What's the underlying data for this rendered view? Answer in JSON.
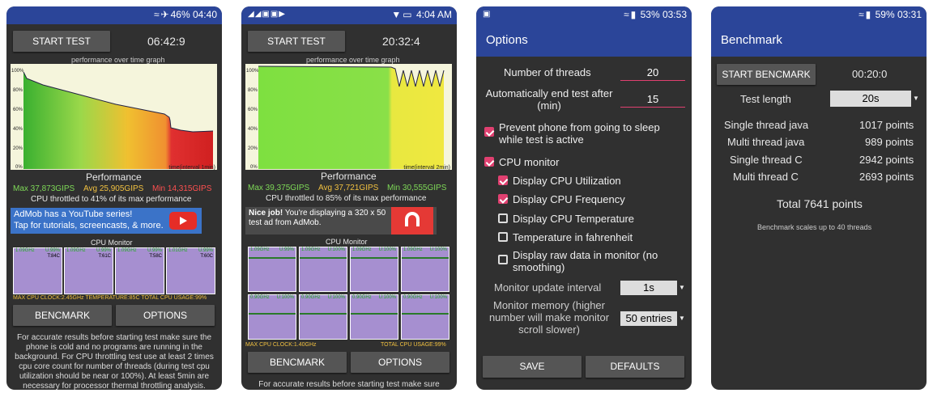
{
  "screens": [
    {
      "status": {
        "left": "",
        "right": "46% 04:40"
      },
      "start_test": "START TEST",
      "timer": "06:42:9",
      "graph_title": "performance over time graph",
      "y_ticks": [
        "100%",
        "80%",
        "60%",
        "40%",
        "20%",
        "0%"
      ],
      "graph_xlabel": "time(interval 1min)",
      "perf_label": "Performance",
      "max": "Max 37,873GIPS",
      "avg": "Avg 25,905GIPS",
      "min": "Min 14,315GIPS",
      "throttle": "CPU throttled to 41% of its max performance",
      "ad_line1": "AdMob has a YouTube series!",
      "ad_line2": "Tap for tutorials, screencasts, & more.",
      "cpu_monitor": "CPU Monitor",
      "cores": [
        {
          "ghz": "1.09GHz",
          "u": "U:99%",
          "t": "T:84C"
        },
        {
          "ghz": "1.09GHz",
          "u": "U:99%",
          "t": "T:61C"
        },
        {
          "ghz": "1.09GHz",
          "u": "U:99%",
          "t": "T:58C"
        },
        {
          "ghz": "1.01GHz",
          "u": "U:99%",
          "t": "T:60C"
        }
      ],
      "cpu_footer": "MAX CPU CLOCK:2.45GHz  TEMPERATURE:85C   TOTAL CPU USAGE:99%",
      "benchmark": "BENCMARK",
      "options": "OPTIONS",
      "info": "For accurate results before starting test make sure the phone is cold and no programs are running in the background. For CPU throttling test use at least 2 times cpu core count for number of threads (during test cpu utilization should be near or 100%). At least 5min are necessary for processor thermal throttling analysis. Phone will heat up"
    },
    {
      "status": {
        "left": "",
        "right": "4:04 AM"
      },
      "start_test": "START TEST",
      "timer": "20:32:4",
      "graph_title": "performance over time graph",
      "y_ticks": [
        "100%",
        "80%",
        "60%",
        "40%",
        "20%",
        "0%"
      ],
      "graph_xlabel": "time(interval 2min)",
      "perf_label": "Performance",
      "max": "Max 39,375GIPS",
      "avg": "Avg 37,721GIPS",
      "min": "Min 30,555GIPS",
      "throttle": "CPU throttled to 85% of its max performance",
      "ad_bold": "Nice job!",
      "ad_text": " You're displaying a 320 x 50 test ad from AdMob.",
      "cpu_monitor": "CPU Monitor",
      "cores": [
        {
          "ghz": "1.09GHz",
          "u": "U:99%"
        },
        {
          "ghz": "1.09GHz",
          "u": "U:100%"
        },
        {
          "ghz": "1.09GHz",
          "u": "U:100%"
        },
        {
          "ghz": "1.09GHz",
          "u": "U:100%"
        },
        {
          "ghz": "0.90GHz",
          "u": "U:100%"
        },
        {
          "ghz": "0.90GHz",
          "u": "U:100%"
        },
        {
          "ghz": "0.90GHz",
          "u": "U:100%"
        },
        {
          "ghz": "0.90GHz",
          "u": "U:100%"
        }
      ],
      "cpu_footer_l": "MAX CPU CLOCK:1.40GHz",
      "cpu_footer_r": "TOTAL CPU USAGE:99%",
      "benchmark": "BENCMARK",
      "options": "OPTIONS",
      "info": "For accurate results before starting test make sure"
    },
    {
      "status": {
        "right": "53% 03:53"
      },
      "title": "Options",
      "threads_label": "Number of threads",
      "threads_value": "20",
      "autoend_label": "Automatically end test after (min)",
      "autoend_value": "15",
      "prevent_sleep": "Prevent phone from going to sleep while test is active",
      "cpu_monitor": "CPU monitor",
      "disp_util": "Display CPU Utilization",
      "disp_freq": "Display CPU Frequency",
      "disp_temp": "Display CPU Temperature",
      "temp_f": "Temperature in fahrenheit",
      "raw_data": "Display raw data in monitor (no smoothing)",
      "interval_label": "Monitor update interval",
      "interval_value": "1s",
      "memory_label": "Monitor memory (higher number will make monitor scroll slower)",
      "memory_value": "50 entries",
      "save": "SAVE",
      "defaults": "DEFAULTS"
    },
    {
      "status": {
        "right": "59% 03:31"
      },
      "title": "Benchmark",
      "start": "START BENCMARK",
      "timer": "00:20:0",
      "length_label": "Test length",
      "length_value": "20s",
      "results": [
        {
          "name": "Single thread java",
          "value": "1017 points"
        },
        {
          "name": "Multi thread java",
          "value": "989 points"
        },
        {
          "name": "Single thread C",
          "value": "2942 points"
        },
        {
          "name": "Multi thread C",
          "value": "2693 points"
        }
      ],
      "total": "Total 7641 points",
      "note": "Benchmark scales up to 40 threads"
    }
  ],
  "colors": {
    "accent": "#e04070",
    "bar": "#2b4599",
    "max": "#7ed957",
    "avg": "#f0c040",
    "min": "#ff5050"
  }
}
